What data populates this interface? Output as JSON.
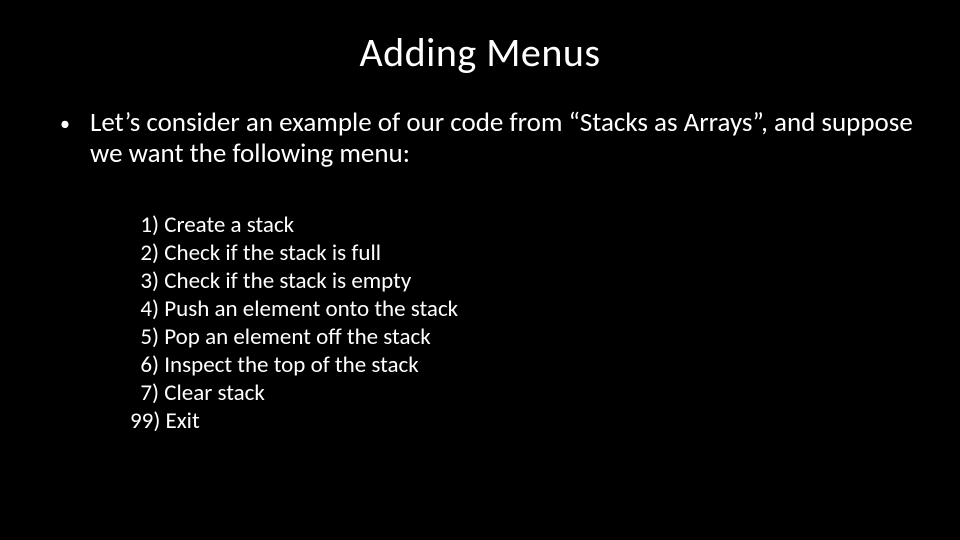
{
  "title": "Adding Menus",
  "bullet": {
    "dot": "•",
    "text": "Let’s consider an example of our code from “Stacks as Arrays”, and suppose we want the following menu:"
  },
  "menu": {
    "items": [
      "  1) Create a stack",
      "  2) Check if the stack is full",
      "  3) Check if the stack is empty",
      "  4) Push an element onto the stack",
      "  5) Pop an element off the stack",
      "  6) Inspect the top of the stack",
      "  7) Clear stack",
      "99) Exit"
    ]
  }
}
